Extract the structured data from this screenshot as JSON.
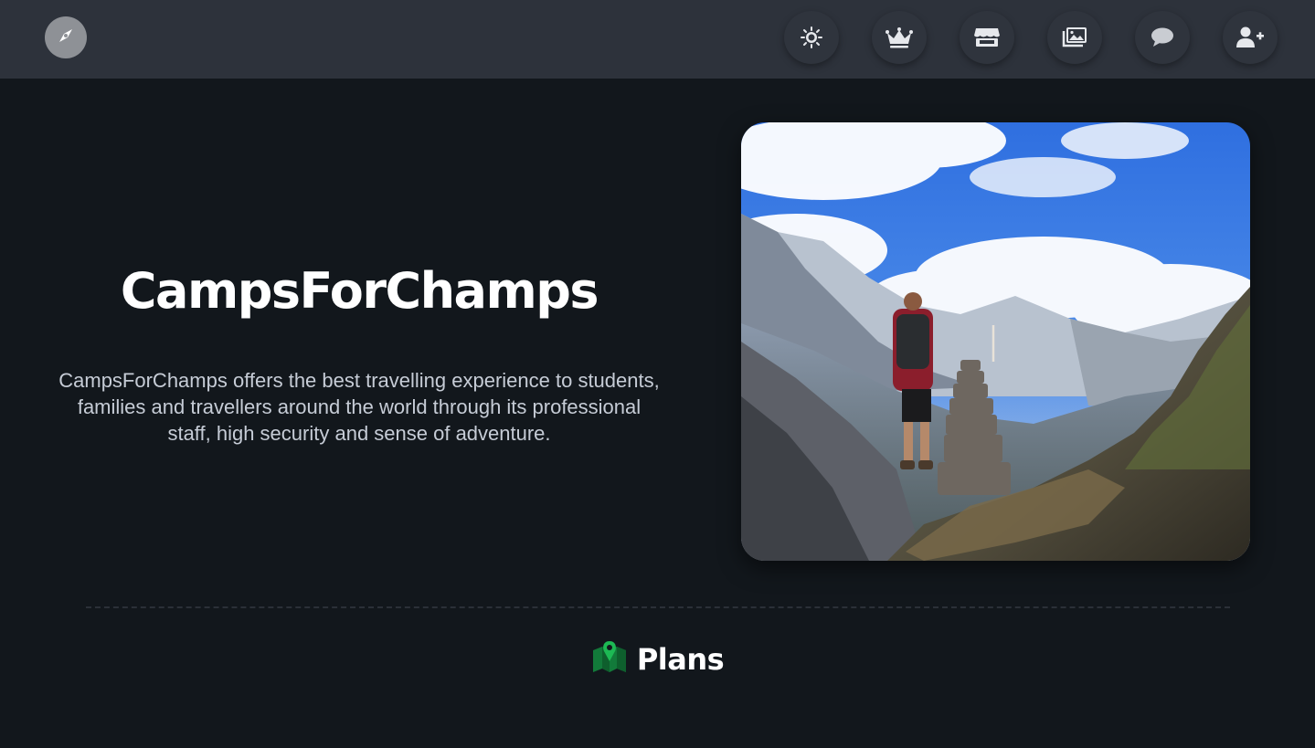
{
  "nav": {
    "logo_icon": "compass-icon",
    "buttons": [
      {
        "name": "theme-toggle-button",
        "icon": "sun-icon"
      },
      {
        "name": "premium-button",
        "icon": "crown-icon"
      },
      {
        "name": "store-button",
        "icon": "store-icon"
      },
      {
        "name": "gallery-button",
        "icon": "images-icon"
      },
      {
        "name": "chat-button",
        "icon": "comment-icon"
      },
      {
        "name": "sign-up-button",
        "icon": "user-plus-icon"
      }
    ],
    "icon_color": "#e6e8ec",
    "background": "#2d323b"
  },
  "hero": {
    "title": "CampsForChamps",
    "description": "CampsForChamps offers the best travelling experience to students, families and travellers around the world through its professional staff, high security and sense of adventure.",
    "image_subject": "hiker-on-mountain-ridge"
  },
  "plans": {
    "heading": "Plans",
    "icon": "map-marker-icon",
    "icon_color": "#1db954"
  },
  "colors": {
    "page_background": "#12171c",
    "title_text": "#ffffff",
    "body_text": "#c6ccd6"
  }
}
